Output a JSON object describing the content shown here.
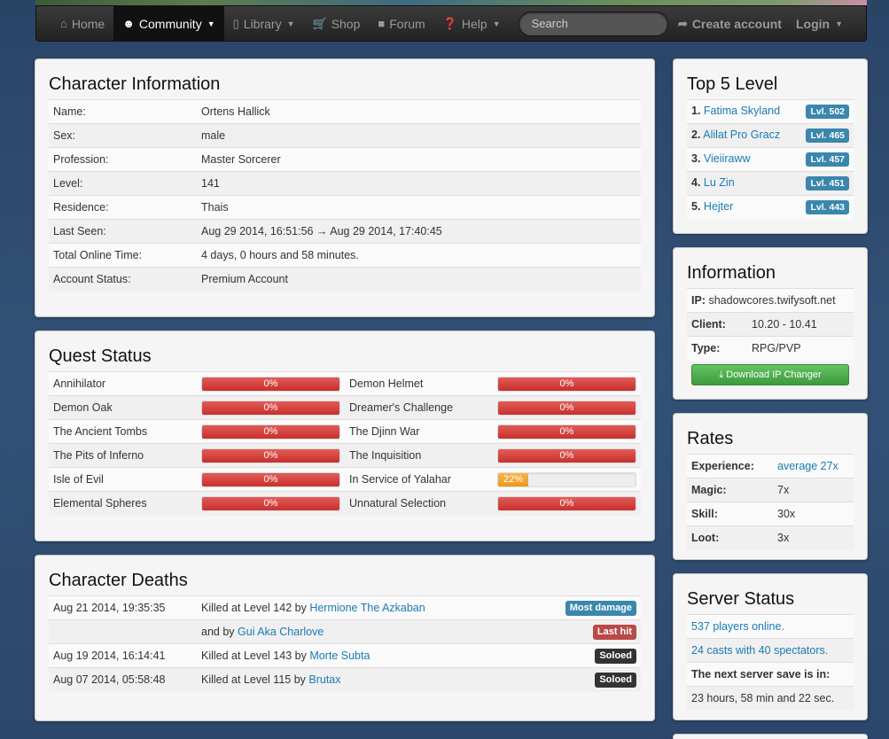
{
  "nav": {
    "home": "Home",
    "community": "Community",
    "library": "Library",
    "shop": "Shop",
    "forum": "Forum",
    "help": "Help",
    "search_placeholder": "Search",
    "create_account": "Create account",
    "login": "Login"
  },
  "character_info": {
    "title": "Character Information",
    "rows": [
      {
        "key": "Name:",
        "value": "Ortens Hallick"
      },
      {
        "key": "Sex:",
        "value": "male"
      },
      {
        "key": "Profession:",
        "value": "Master Sorcerer"
      },
      {
        "key": "Level:",
        "value": "141"
      },
      {
        "key": "Residence:",
        "value": "Thais"
      },
      {
        "key": "Last Seen:",
        "value": "Aug 29 2014, 16:51:56 → Aug 29 2014, 17:40:45"
      },
      {
        "key": "Total Online Time:",
        "value": "4 days, 0 hours and 58 minutes."
      },
      {
        "key": "Account Status:",
        "value": "Premium Account"
      }
    ]
  },
  "quest_status": {
    "title": "Quest Status",
    "rows": [
      {
        "q1": "Annihilator",
        "p1": "0%",
        "q2": "Demon Helmet",
        "p2": "0%"
      },
      {
        "q1": "Demon Oak",
        "p1": "0%",
        "q2": "Dreamer's Challenge",
        "p2": "0%"
      },
      {
        "q1": "The Ancient Tombs",
        "p1": "0%",
        "q2": "The Djinn War",
        "p2": "0%"
      },
      {
        "q1": "The Pits of Inferno",
        "p1": "0%",
        "q2": "The Inquisition",
        "p2": "0%"
      },
      {
        "q1": "Isle of Evil",
        "p1": "0%",
        "q2": "In Service of Yalahar",
        "p2": "22%"
      },
      {
        "q1": "Elemental Spheres",
        "p1": "0%",
        "q2": "Unnatural Selection",
        "p2": "0%"
      }
    ]
  },
  "deaths": {
    "title": "Character Deaths",
    "rows": [
      {
        "date": "Aug 21 2014, 19:35:35",
        "prefix": "Killed at Level 142 by ",
        "killer": "Hermione The Azkaban",
        "badge": "Most damage"
      },
      {
        "date": "",
        "prefix": "and by ",
        "killer": "Gui Aka Charlove",
        "badge": "Last hit"
      },
      {
        "date": "Aug 19 2014, 16:14:41",
        "prefix": "Killed at Level 143 by ",
        "killer": "Morte Subta",
        "badge": "Soloed"
      },
      {
        "date": "Aug 07 2014, 05:58:48",
        "prefix": "Killed at Level 115 by ",
        "killer": "Brutax",
        "badge": "Soloed"
      }
    ]
  },
  "top5": {
    "title": "Top 5 Level",
    "rows": [
      {
        "rank": "1.",
        "name": "Fatima Skyland",
        "level": "Lvl. 502"
      },
      {
        "rank": "2.",
        "name": "Alilat Pro Gracz",
        "level": "Lvl. 465"
      },
      {
        "rank": "3.",
        "name": "Vieiiraww",
        "level": "Lvl. 457"
      },
      {
        "rank": "4.",
        "name": "Lu Zin",
        "level": "Lvl. 451"
      },
      {
        "rank": "5.",
        "name": "Hejter",
        "level": "Lvl. 443"
      }
    ]
  },
  "information": {
    "title": "Information",
    "ip_label": "IP:",
    "ip_value": "shadowcores.twifysoft.net",
    "client_label": "Client:",
    "client_value": "10.20 - 10.41",
    "type_label": "Type:",
    "type_value": "RPG/PVP",
    "download_button": "Download IP Changer"
  },
  "rates": {
    "title": "Rates",
    "rows": [
      {
        "key": "Experience:",
        "value": "average 27x"
      },
      {
        "key": "Magic:",
        "value": "7x"
      },
      {
        "key": "Skill:",
        "value": "30x"
      },
      {
        "key": "Loot:",
        "value": "3x"
      }
    ]
  },
  "server_status": {
    "title": "Server Status",
    "players_online": "537 players online.",
    "casts": "24 casts with 40 spectators.",
    "save_label": "The next server save is in:",
    "save_time": "23 hours, 58 min and 22 sec."
  },
  "colors": {
    "accent": "#1a7ab5",
    "progress_red": "#c9302c",
    "progress_orange": "#ec971f",
    "badge_blue": "#3a87ad",
    "badge_red": "#b94a48",
    "badge_dark": "#333333",
    "button_green": "#3e9a3e"
  },
  "quest_progress_fraction": {
    "in_service_of_yalahar": 0.22
  }
}
